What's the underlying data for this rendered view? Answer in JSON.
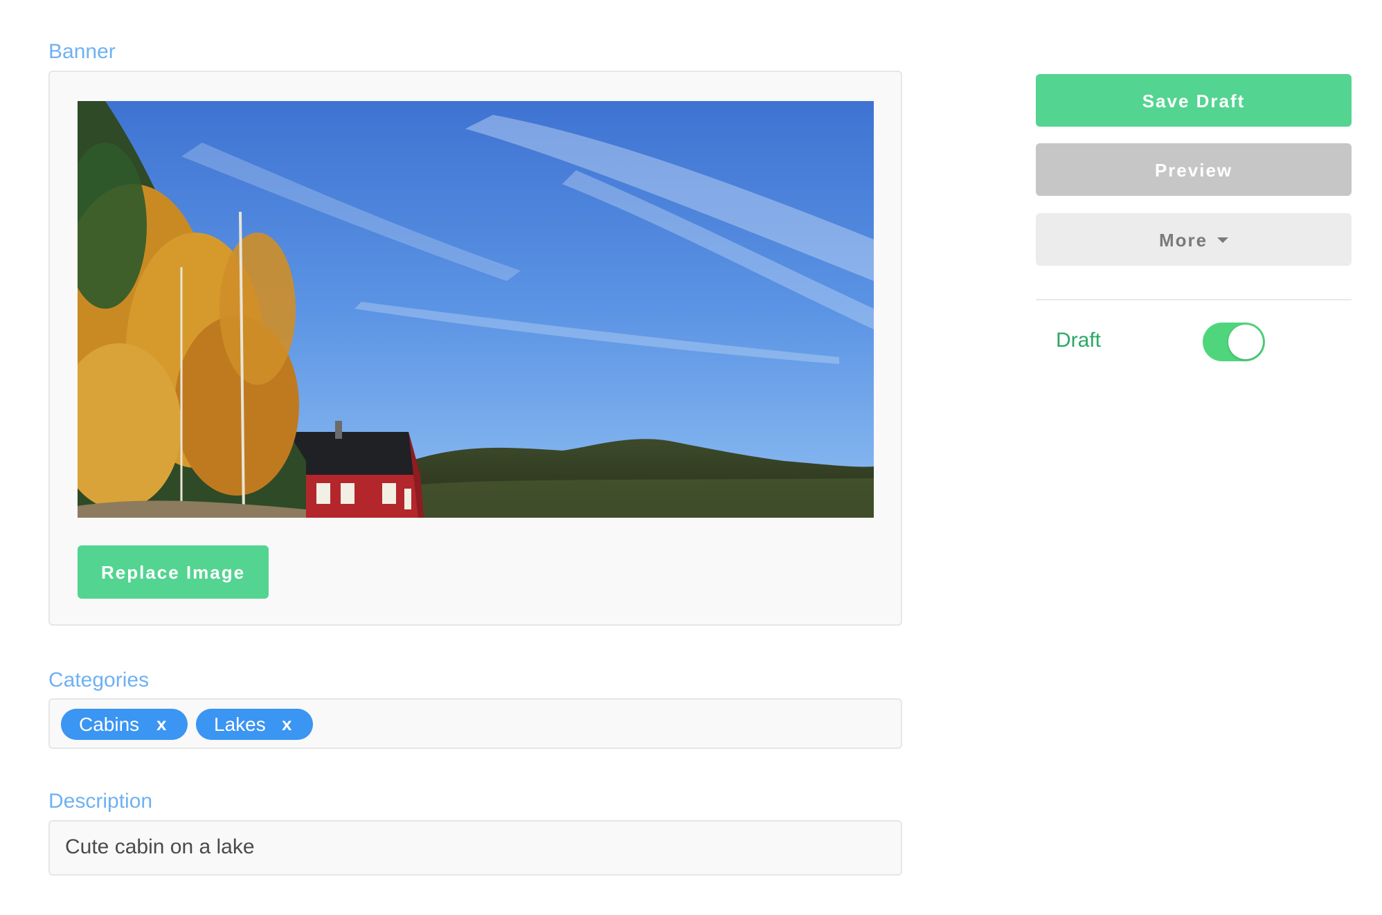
{
  "banner": {
    "label": "Banner",
    "image_alt": "Red cabin by a lake with autumn trees and blue sky",
    "replace_button_label": "Replace Image"
  },
  "sidebar": {
    "save_label": "Save Draft",
    "preview_label": "Preview",
    "more_label": "More",
    "draft_label": "Draft",
    "draft_enabled": true
  },
  "categories": {
    "label": "Categories",
    "tags": [
      {
        "label": "Cabins",
        "remove": "x"
      },
      {
        "label": "Lakes",
        "remove": "x"
      }
    ]
  },
  "description": {
    "label": "Description",
    "value": "Cute cabin on a lake"
  },
  "colors": {
    "accent_green": "#53d491",
    "label_blue": "#6fb1f2",
    "tag_blue": "#3b95f2",
    "toggle_green": "#4fd67d"
  }
}
